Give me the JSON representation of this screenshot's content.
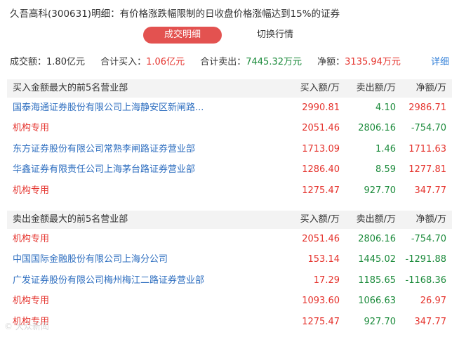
{
  "header": {
    "title": "久吾高科(300631)明细：有价格涨跌幅限制的日收盘价格涨幅达到15%的证券"
  },
  "tabs": [
    {
      "label": "成交明细",
      "active": true
    },
    {
      "label": "切换行情",
      "active": false
    }
  ],
  "summary": {
    "turnover_label": "成交额：",
    "turnover_value": "1.80亿元",
    "buy_label": "合计买入：",
    "buy_value": "1.06亿元",
    "sell_label": "合计卖出：",
    "sell_value": "7445.32万元",
    "net_label": "净额：",
    "net_value": "3135.94万元",
    "detail_link": "详细"
  },
  "colors": {
    "accent": "#e35250",
    "link": "#2f6fc0",
    "up": "#e5332d",
    "down": "#1a8a3a"
  },
  "buy_section": {
    "title": "买入金额最大的前5名营业部",
    "columns": [
      "买入额/万",
      "卖出额/万",
      "净额/万"
    ],
    "rows": [
      {
        "name": "国泰海通证券股份有限公司上海静安区新闸路...",
        "name_color": "blue",
        "buy": "2990.81",
        "sell": "4.10",
        "net": "2986.71",
        "net_color": "red"
      },
      {
        "name": "机构专用",
        "name_color": "red",
        "buy": "2051.46",
        "sell": "2806.16",
        "net": "-754.70",
        "net_color": "green"
      },
      {
        "name": "东方证券股份有限公司常熟李闸路证券营业部",
        "name_color": "blue",
        "buy": "1713.09",
        "sell": "1.46",
        "net": "1711.63",
        "net_color": "red"
      },
      {
        "name": "华鑫证券有限责任公司上海茅台路证券营业部",
        "name_color": "blue",
        "buy": "1286.40",
        "sell": "8.59",
        "net": "1277.81",
        "net_color": "red"
      },
      {
        "name": "机构专用",
        "name_color": "red",
        "buy": "1275.47",
        "sell": "927.70",
        "net": "347.77",
        "net_color": "red"
      }
    ]
  },
  "sell_section": {
    "title": "卖出金额最大的前5名营业部",
    "columns": [
      "买入额/万",
      "卖出额/万",
      "净额/万"
    ],
    "rows": [
      {
        "name": "机构专用",
        "name_color": "red",
        "buy": "2051.46",
        "sell": "2806.16",
        "net": "-754.70",
        "net_color": "green"
      },
      {
        "name": "中国国际金融股份有限公司上海分公司",
        "name_color": "blue",
        "buy": "153.14",
        "sell": "1445.02",
        "net": "-1291.88",
        "net_color": "green"
      },
      {
        "name": "广发证券股份有限公司梅州梅江二路证券营业部",
        "name_color": "blue",
        "buy": "17.29",
        "sell": "1185.65",
        "net": "-1168.36",
        "net_color": "green"
      },
      {
        "name": "机构专用",
        "name_color": "red",
        "buy": "1093.60",
        "sell": "1066.63",
        "net": "26.97",
        "net_color": "red"
      },
      {
        "name": "机构专用",
        "name_color": "red",
        "buy": "1275.47",
        "sell": "927.70",
        "net": "347.77",
        "net_color": "red"
      }
    ]
  },
  "watermark": "© 大众新闻"
}
